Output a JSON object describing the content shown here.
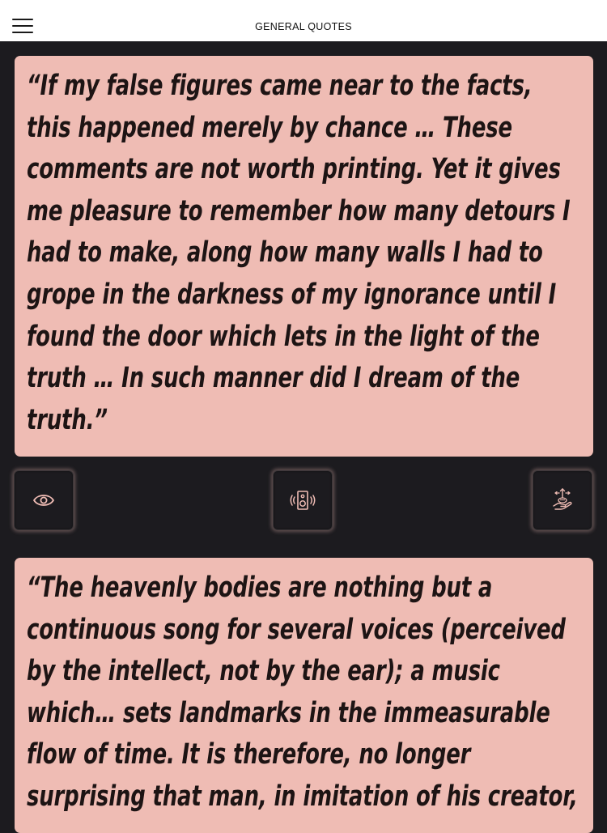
{
  "header": {
    "title": "GENERAL QUOTES",
    "menu_icon": "hamburger-menu-icon"
  },
  "colors": {
    "card_background": "#efbcb4",
    "page_background": "#1c1b1f",
    "header_background": "#ffffff",
    "quote_text": "#1d1414",
    "icon_stroke": "#efbcb4"
  },
  "quotes": [
    {
      "text": "“If my false figures came near to the facts, this happened merely by chance … These comments are not worth printing. Yet it gives me pleasure to remember how many detours I had to make, along how many walls I had to grope in the darkness of my ignorance until I found the door which lets in the light of the truth … In such manner did I dream of the truth.”"
    },
    {
      "text": "“The heavenly bodies are nothing but a continuous song for several voices (perceived by the intellect, not by the ear); a music which… sets landmarks in the immeasurable flow of time. It is therefore, no longer surprising that man, in imitation of his creator,"
    }
  ],
  "actions": [
    {
      "name": "view",
      "icon": "eye-icon"
    },
    {
      "name": "speak",
      "icon": "speaker-icon"
    },
    {
      "name": "share",
      "icon": "hand-offering-icon"
    }
  ]
}
